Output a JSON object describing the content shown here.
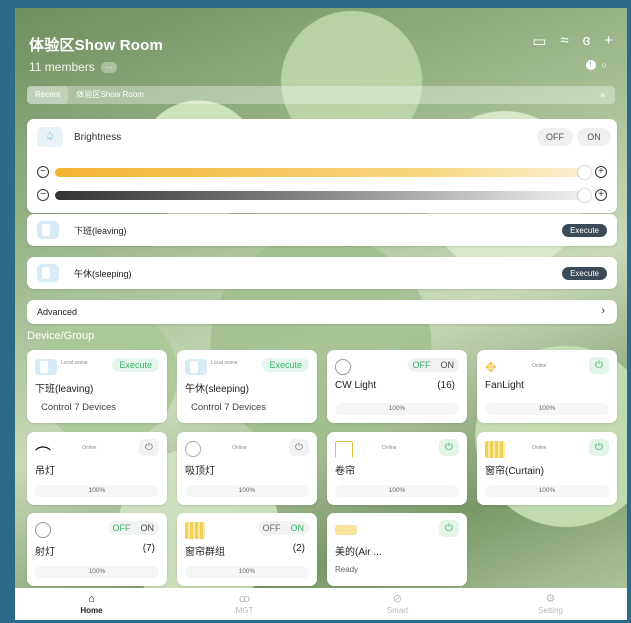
{
  "header": {
    "title": "体验区Show Room",
    "members": "11 members"
  },
  "tabs": [
    "Recent",
    "体验区Show Room"
  ],
  "brightness": {
    "label": "Brightness",
    "off": "OFF",
    "on": "ON"
  },
  "scenes": [
    {
      "label": "下班(leaving)",
      "action": "Execute"
    },
    {
      "label": "午休(sleeping)",
      "action": "Execute"
    }
  ],
  "advanced": {
    "label": "Advanced"
  },
  "section_title": "Device/Group",
  "tiles": {
    "t1": {
      "tag": "Local scene",
      "action": "Execute",
      "name": "下班(leaving)",
      "sub": "Control 7 Devices"
    },
    "t2": {
      "tag": "Local scene",
      "action": "Execute",
      "name": "午休(sleeping)",
      "sub": "Control 7 Devices"
    },
    "t3": {
      "off": "OFF",
      "on": "ON",
      "name": "CW Light",
      "count": "(16)",
      "level": "100%"
    },
    "t4": {
      "status": "Online",
      "name": "FanLight",
      "level": "100%"
    },
    "t5": {
      "status": "Online",
      "name": "吊灯",
      "level": "100%"
    },
    "t6": {
      "status": "Online",
      "name": "吸顶灯",
      "level": "100%"
    },
    "t7": {
      "status": "Online",
      "name": "卷帘",
      "level": "100%"
    },
    "t8": {
      "status": "Online",
      "name": "窗帘(Curtain)",
      "level": "100%"
    },
    "t9": {
      "off": "OFF",
      "on": "ON",
      "name": "射灯",
      "count": "(7)",
      "level": "100%"
    },
    "t10": {
      "off": "OFF",
      "on": "ON",
      "name": "窗帘群组",
      "count": "(2)",
      "level": "100%"
    },
    "t11": {
      "name": "美的(Air ...",
      "status": "Ready"
    }
  },
  "nav": {
    "home": "Home",
    "mgt": "MGT",
    "smart": "Smart",
    "setting": "Setting"
  },
  "colors": {
    "accent_green": "#37b062",
    "execute_dark": "#3b4a56",
    "warm_track": "#f4b233"
  }
}
